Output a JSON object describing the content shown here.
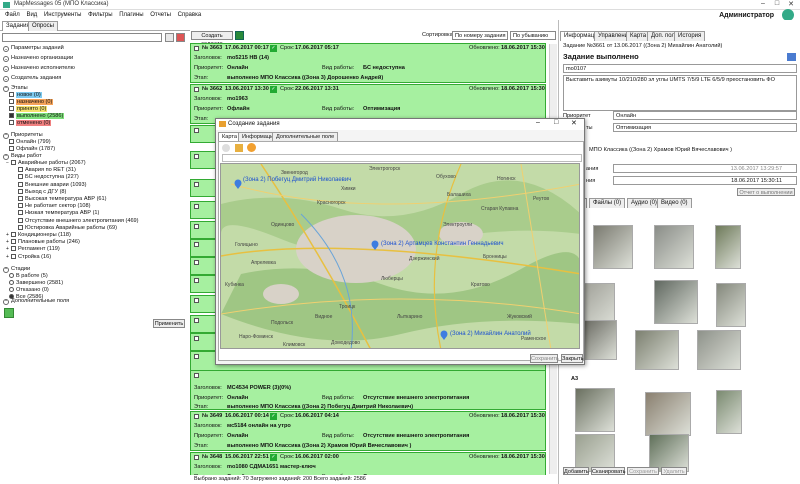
{
  "window": {
    "title": "MapMessages 05 (МПО Классика)",
    "user": "Администратор"
  },
  "menu": [
    "Файл",
    "Вид",
    "Инструменты",
    "Фильтры",
    "Плагины",
    "Отчеты",
    "Справка"
  ],
  "left_tabs": [
    "Задания",
    "Опросы"
  ],
  "filters": {
    "sections": {
      "params": "Параметры заданий",
      "orgs": "Назначено организации",
      "exec": "Назначено исполнителю",
      "creator": "Создатель задания",
      "stages": "Этапы",
      "priorities": "Приоритеты",
      "worktypes": "Виды работ",
      "statuses": "Стадии",
      "extra": "Дополнительные поля"
    },
    "stages": [
      {
        "label": "новое (0)",
        "color": "#7ecbf0"
      },
      {
        "label": "назначено (0)",
        "color": "#f5a35a"
      },
      {
        "label": "принято (0)",
        "color": "#f5e36e"
      },
      {
        "label": "выполнено (2586)",
        "color": "#7ee07a"
      },
      {
        "label": "отменено (0)",
        "color": "#f08080"
      }
    ],
    "priorities": [
      "Онлайн (799)",
      "Офлайн (1787)"
    ],
    "worktypes": [
      {
        "label": "Аварийные работы (2067)",
        "level": 1,
        "exp": "minus"
      },
      {
        "label": "Авария по RET (31)",
        "level": 2
      },
      {
        "label": "БС недоступна (227)",
        "level": 2
      },
      {
        "label": "Внешние аварии (1093)",
        "level": 2
      },
      {
        "label": "Выход с ДГУ (8)",
        "level": 2
      },
      {
        "label": "Высокая температура АВР (61)",
        "level": 2
      },
      {
        "label": "Не работает сектор (108)",
        "level": 2
      },
      {
        "label": "Низкая температура АВР (1)",
        "level": 2
      },
      {
        "label": "Отсутствие внешнего электропитания (469)",
        "level": 2
      },
      {
        "label": "Юстировка Аварийные работы (69)",
        "level": 2
      },
      {
        "label": "Кондиционеры (118)",
        "level": 1,
        "exp": "plus"
      },
      {
        "label": "Плановые работы (246)",
        "level": 1,
        "exp": "plus"
      },
      {
        "label": "Регламент (119)",
        "level": 1,
        "exp": "plus"
      },
      {
        "label": "Стройка (16)",
        "level": 1,
        "exp": "plus"
      }
    ],
    "statuses": [
      {
        "label": "В работе (5)",
        "on": false
      },
      {
        "label": "Завершено (2581)",
        "on": false
      },
      {
        "label": "Отказано (0)",
        "on": false
      },
      {
        "label": "Все (2586)",
        "on": true
      }
    ],
    "apply": "Применить"
  },
  "middle": {
    "create_btn": "Создать задание",
    "sort_label": "Сортировка",
    "sort_by": "По номеру задания",
    "sort_dir": "По убыванию",
    "status": "Выбрано заданий: 70 Загружено заданий: 200 Всего заданий: 2586",
    "labels": {
      "ttl": "Заголовок:",
      "pri": "Приоритет:",
      "stage": "Этап:",
      "wt": "Вид работы:",
      "term": "Срок:",
      "upd": "Обновлено:"
    },
    "tasks": [
      {
        "no": "№ 3663",
        "created": "17.06.2017 00:17",
        "term": "17.06.2017 05:17",
        "updated": "18.06.2017 15:30",
        "title": "mo5215 HB (14)",
        "priority": "Онлайн",
        "worktype": "БС недоступна",
        "stage": "выполнено МПО Классика ((Зона 3) Дорошенко Андрей)"
      },
      {
        "no": "№ 3662",
        "created": "13.06.2017 13:30",
        "term": "22.06.2017 13:31",
        "updated": "18.06.2017 15:30",
        "title": "mo1963",
        "priority": "Офлайн",
        "worktype": "Оптимизация",
        "stage": ""
      },
      {
        "no": "№ 3649",
        "created": "16.06.2017 00:14",
        "term": "16.06.2017 04:14",
        "updated": "18.06.2017 15:30",
        "title": "мс5184 онлайн на утро",
        "priority": "Онлайн",
        "worktype": "Отсутствие внешнего электропитания",
        "stage": "выполнено МПО Классика ((Зона 2) Храмов Юрий Вячеславович )"
      },
      {
        "no": "№ 3648",
        "created": "15.06.2017 22:51",
        "term": "16.06.2017 02:00",
        "updated": "18.06.2017 15:30",
        "title": "mo1080 СДМА1651 мастер-ключ",
        "priority": "Онлайн",
        "worktype": "Отсутствие внешнего электропитания",
        "stage": ""
      }
    ],
    "partial_title": "МС4534 POWER (3)(0%)",
    "partial_priority": "Онлайн",
    "partial_worktype": "Отсутствие внешнего электропитания",
    "partial_stage": "выполнено МПО Классика ((Зона 2) Побегуц Дмитрий Николаевич)"
  },
  "right": {
    "tabs": [
      "Информация",
      "Управление",
      "Карта",
      "Доп. поля",
      "История"
    ],
    "task_info": "Задание №3661 от 13.06.2017 ((Зона 2) Михайлин Анатолий)",
    "status_title": "Задание выполнено",
    "code": "mo0107",
    "description": "Выставить азимуты 10/210/280 эл углы UMTS 7/5/9 LTE 6/5/9 преостановить ФО",
    "priority_lbl": "Приоритет",
    "priority": "Онлайн",
    "type_lbl": "ты",
    "type": "Оптимизация",
    "executor": "МПО Классика ((Зона 2) Храмов Юрий Вячеславович )",
    "date1_lbl": "ания",
    "date1": "13.06.2017 13:29:57",
    "date2_lbl": "ния",
    "date2": "18.06.2017 15:30:11",
    "report_btn": "Отчет о выполнении",
    "media_tabs": [
      "Файлы (0)",
      "Аудио (0)",
      "Видео (0)"
    ],
    "group_a3": "А3",
    "bottom_btns": [
      "Добавить",
      "Сканировать",
      "Сохранить",
      "Удалить"
    ]
  },
  "dialog": {
    "title": "Создание задания",
    "tabs": [
      "Карта",
      "Информация",
      "Дополнительные поле"
    ],
    "save": "Сохранить",
    "close": "Закрыть",
    "pins": [
      "(Зона 2) Побегуц Дмитрий Николаевич",
      "(Зона 2) Артамцев Константин Геннадьевич",
      "(Зона 2) Михайлин Анатолий"
    ],
    "places": [
      "Звенигород",
      "Электрогорск",
      "Обухово",
      "Ногинск",
      "Старая Купавна",
      "Электроугли",
      "Дзержинский",
      "Люберцы",
      "Лыткарино",
      "Кратово",
      "Жуковский",
      "Раменское",
      "Бронницы",
      "Домодедово",
      "Видное",
      "Подольск",
      "Климовск",
      "Красногорск",
      "Одинцово",
      "Голицыно",
      "Кубинка",
      "Наро-Фоминск",
      "Апрелевка",
      "Троицк",
      "Балашиха",
      "Реутов",
      "Химки"
    ]
  }
}
